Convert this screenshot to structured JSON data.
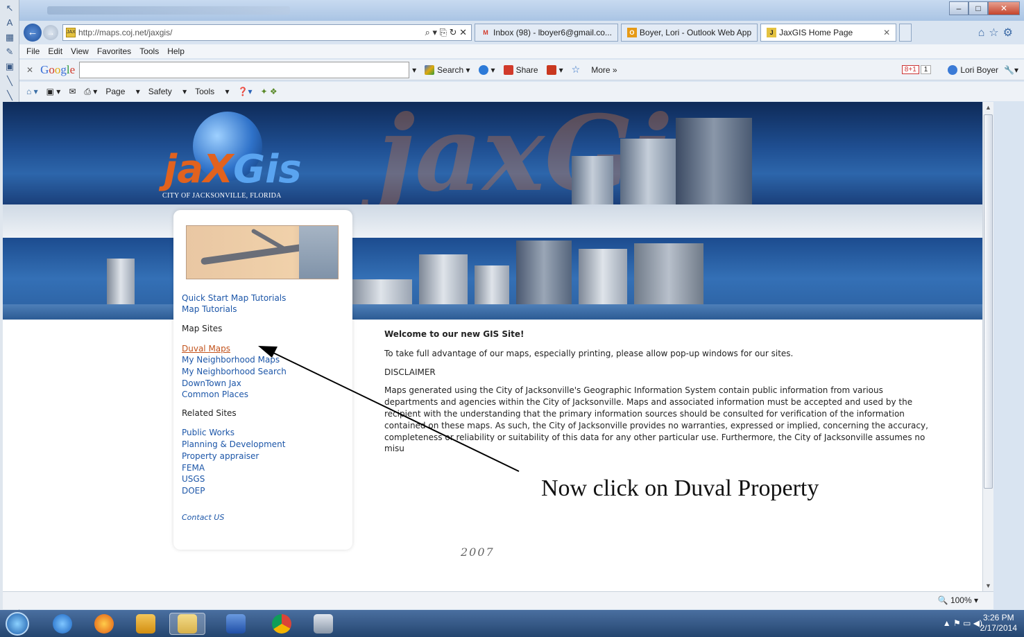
{
  "browser": {
    "url": "http://maps.coj.net/jaxgis/",
    "tabs": [
      {
        "label": "Inbox (98) - lboyer6@gmail.co...",
        "icon": "gmail-icon",
        "active": false
      },
      {
        "label": "Boyer, Lori - Outlook Web App",
        "icon": "outlook-icon",
        "active": false
      },
      {
        "label": "JaxGIS Home Page",
        "icon": "jaxgis-icon",
        "active": true
      }
    ],
    "menu": [
      "File",
      "Edit",
      "View",
      "Favorites",
      "Tools",
      "Help"
    ],
    "google_toolbar": {
      "logo": "Google",
      "search_label": "Search",
      "share_label": "Share",
      "more_label": "More »",
      "gplus": "8+1",
      "gplus_count": "1",
      "user": "Lori Boyer"
    },
    "command_bar": [
      "Page",
      "Safety",
      "Tools"
    ],
    "status": {
      "zoom": "100%"
    }
  },
  "site": {
    "logo_text": "jaxGis",
    "logo_sub": "CITY OF JACKSONVILLE, FLORIDA",
    "nav": {
      "tutorials": [
        "Quick Start Map Tutorials",
        "Map Tutorials"
      ],
      "map_sites_heading": "Map Sites",
      "map_sites": [
        "Duval Maps",
        "My Neighborhood Maps",
        "My Neighborhood Search",
        "DownTown Jax",
        "Common Places"
      ],
      "related_heading": "Related Sites",
      "related": [
        "Public Works",
        "Planning & Development",
        "Property appraiser",
        "FEMA",
        "USGS",
        "DOEP"
      ],
      "contact": "Contact US"
    },
    "main": {
      "welcome": "Welcome to our new GIS Site!",
      "popup_note": "To take full advantage of our maps, especially printing, please allow pop-up windows for our sites.",
      "disclaimer_heading": "DISCLAIMER",
      "disclaimer_body": "Maps generated using the City of Jacksonville's Geographic Information System contain public information from various departments and agencies within the City of Jacksonville. Maps and associated information must be accepted and used by the recipient with the understanding that the primary information sources should be consulted for verification of the information contained on these maps. As such, the City of Jacksonville provides no warranties, expressed or implied, concerning the accuracy, completeness or reliability or suitability of this data for any other particular use. Furthermore, the City of Jacksonville assumes no liability whatsoever associated with the use or",
      "disclaimer_tail": "misu",
      "year": "2007"
    }
  },
  "annotation": {
    "text": "Now click on Duval Property"
  },
  "taskbar": {
    "time": "3:26 PM",
    "date": "2/17/2014"
  }
}
